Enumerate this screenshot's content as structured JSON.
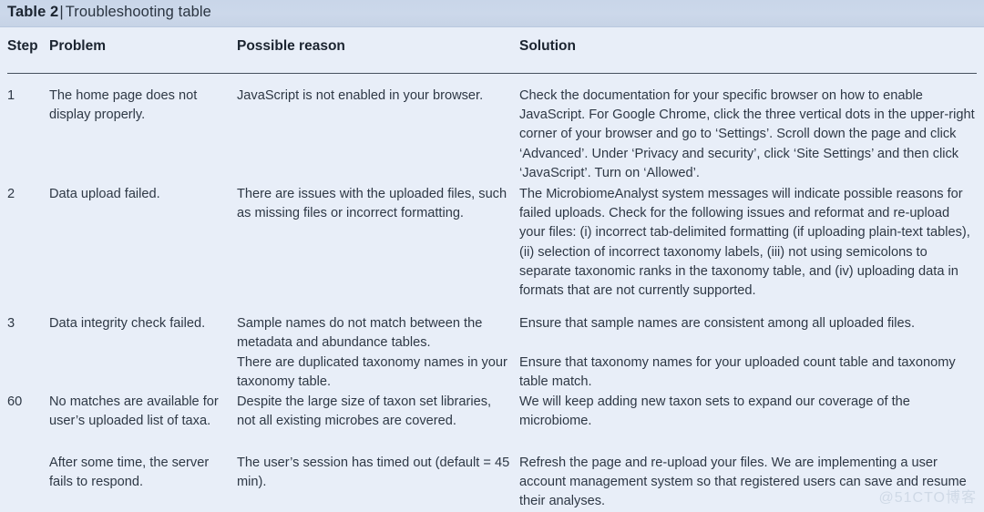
{
  "title": {
    "label": "Table 2",
    "separator": "|",
    "caption": "Troubleshooting table",
    "full": "Table 2 | Troubleshooting table"
  },
  "columns": {
    "step": "Step",
    "problem": "Problem",
    "reason": "Possible reason",
    "solution": "Solution"
  },
  "rows": [
    {
      "step": "1",
      "problem": "The home page does not display properly.",
      "reason": "JavaScript is not enabled in your browser.",
      "solution": "Check the documentation for your specific browser on how to enable JavaScript. For Google Chrome, click the three vertical dots in the upper-right corner of your browser and go to ‘Settings’. Scroll down the page and click ‘Advanced’. Under ‘Privacy and security’, click ‘Site Settings’ and then click ‘JavaScript’. Turn on ‘Allowed’."
    },
    {
      "step": "2",
      "problem": "Data upload failed.",
      "reason": "There are issues with the uploaded files, such as missing files or incorrect formatting.",
      "solution": "The MicrobiomeAnalyst system messages will indicate possible reasons for failed uploads. Check for the following issues and reformat and re-upload your files: (i) incorrect tab-delimited formatting (if uploading plain-text tables), (ii) selection of incorrect taxonomy labels, (iii) not using semicolons to separate taxonomic ranks in the taxonomy table, and (iv) uploading data in formats that are not currently supported."
    },
    {
      "step": "3",
      "problem": "Data integrity check failed.",
      "reason": "Sample names do not match between the metadata and abundance tables.",
      "solution": "Ensure that sample names are consistent among all uploaded files."
    },
    {
      "step": "",
      "problem": "",
      "reason": "There are duplicated taxonomy names in your taxonomy table.",
      "solution": "Ensure that taxonomy names for your uploaded count table and taxonomy table match."
    },
    {
      "step": "60",
      "problem": "No matches are available for user’s uploaded list of taxa.",
      "reason": "Despite the large size of taxon set libraries, not all existing microbes are covered.",
      "solution": "We will keep adding new taxon sets to expand our coverage of the microbiome."
    },
    {
      "step": "",
      "problem": "After some time, the server fails to respond.",
      "reason": "The user’s session has timed out (default = 45 min).",
      "solution": "Refresh the page and re-upload your files. We are implementing a user account management system so that registered users can save and resume their analyses."
    }
  ],
  "watermark": "@51CTO博客",
  "colors": {
    "title_band": "#ccd8ea",
    "body_background": "#e8eef8",
    "rule": "#46505e",
    "text": "#2e3845",
    "heading_text": "#1b2430",
    "watermark": "#cfd9e6"
  }
}
